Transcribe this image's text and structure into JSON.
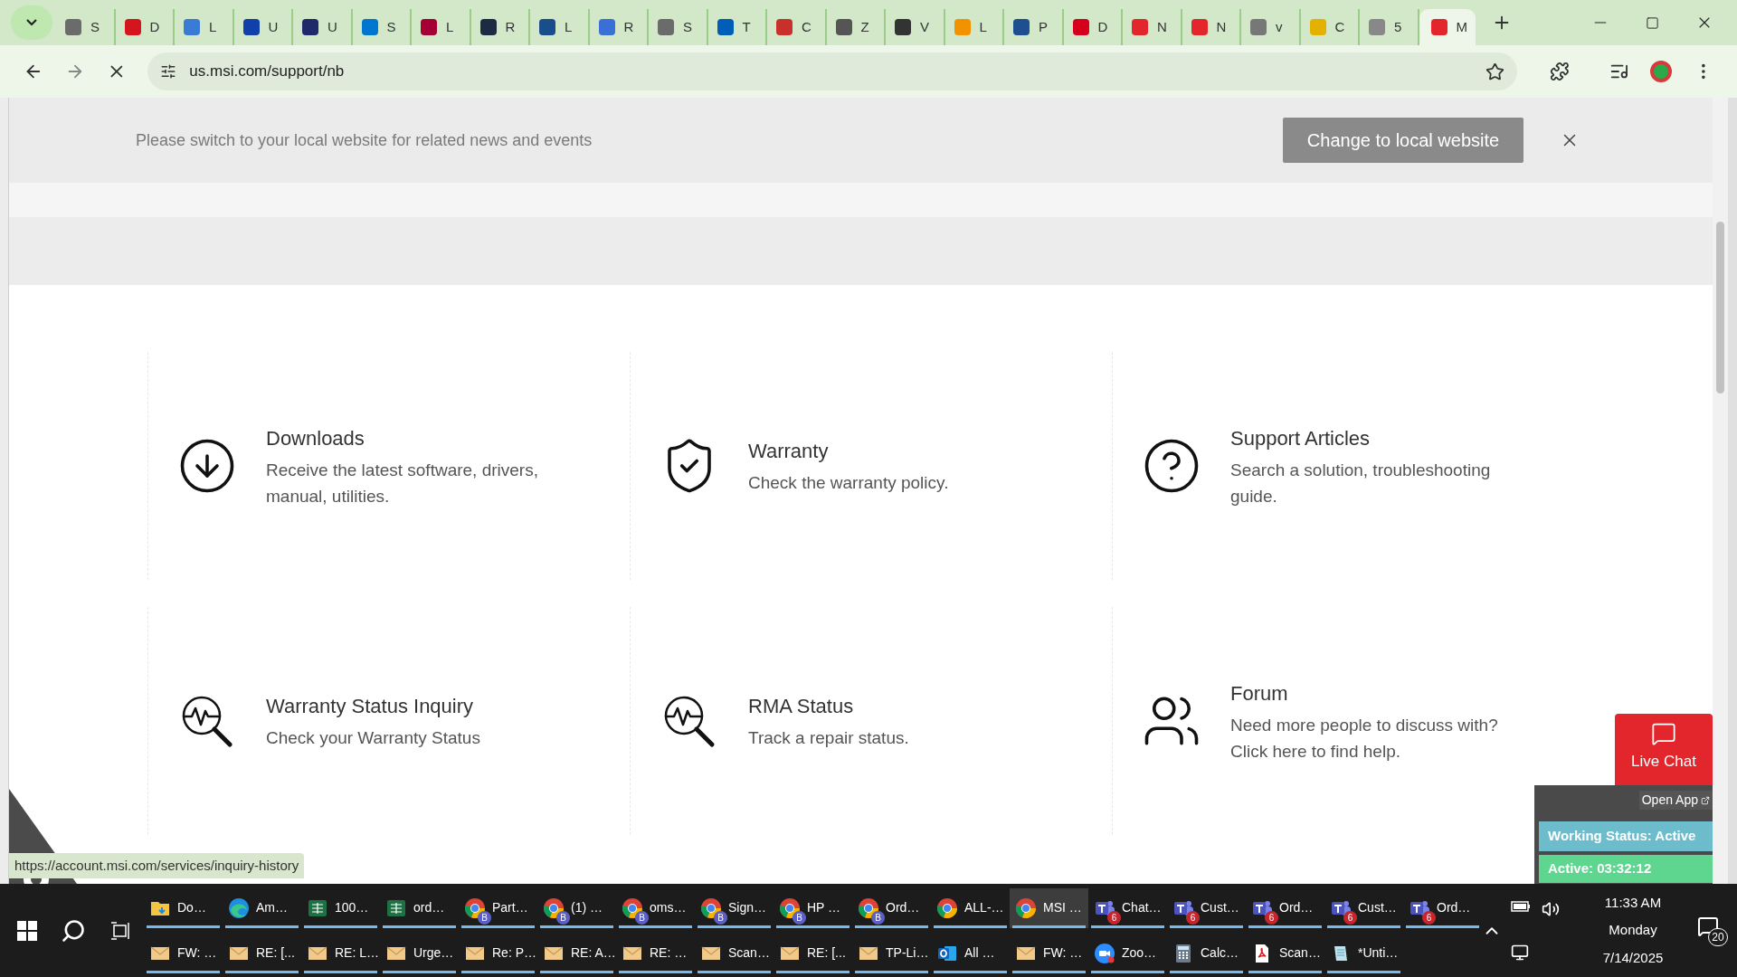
{
  "browser": {
    "tabs": [
      {
        "label": "S",
        "selected": false
      },
      {
        "label": "D",
        "selected": false
      },
      {
        "label": "L",
        "selected": false
      },
      {
        "label": "U",
        "selected": false
      },
      {
        "label": "U",
        "selected": false
      },
      {
        "label": "S",
        "selected": false
      },
      {
        "label": "L",
        "selected": false
      },
      {
        "label": "R",
        "selected": false
      },
      {
        "label": "L",
        "selected": false
      },
      {
        "label": "R",
        "selected": false
      },
      {
        "label": "S",
        "selected": false
      },
      {
        "label": "T",
        "selected": false
      },
      {
        "label": "C",
        "selected": false
      },
      {
        "label": "Z",
        "selected": false
      },
      {
        "label": "V",
        "selected": false
      },
      {
        "label": "L",
        "selected": false
      },
      {
        "label": "P",
        "selected": false
      },
      {
        "label": "D",
        "selected": false
      },
      {
        "label": "N",
        "selected": false
      },
      {
        "label": "N",
        "selected": false
      },
      {
        "label": "v",
        "selected": false
      },
      {
        "label": "C",
        "selected": false
      },
      {
        "label": "5",
        "selected": false
      },
      {
        "label": "M",
        "selected": true
      }
    ],
    "address": "us.msi.com/support/nb"
  },
  "banner": {
    "message": "Please switch to your local website for related news and events",
    "button": "Change to local website"
  },
  "support_links": [
    {
      "kind": "download",
      "title": "Downloads",
      "description": "Receive the latest software, drivers, manual, utilities."
    },
    {
      "kind": "shield",
      "title": "Warranty",
      "description": "Check the warranty policy."
    },
    {
      "kind": "question",
      "title": "Support Articles",
      "description": "Search a solution, troubleshooting guide."
    },
    {
      "kind": "pulse",
      "title": "Warranty Status Inquiry",
      "description": "Check your Warranty Status"
    },
    {
      "kind": "pulse",
      "title": "RMA Status",
      "description": "Track a repair status."
    },
    {
      "kind": "people",
      "title": "Forum",
      "description": "Need more people to discuss with? Click here to find help."
    }
  ],
  "live_chat": {
    "label": "Live Chat"
  },
  "status_widget": {
    "open_app": "Open App",
    "working_status": "Working Status: Active",
    "active_timer": "Active: 03:32:12"
  },
  "status_url": "https://account.msi.com/services/inquiry-history",
  "taskbar": {
    "row_1": [
      {
        "kind": "explorer",
        "label": "Do…",
        "selected": false
      },
      {
        "kind": "edge",
        "label": "Am…",
        "selected": false
      },
      {
        "kind": "excel",
        "label": "100…",
        "selected": false
      },
      {
        "kind": "excel",
        "label": "ord…",
        "selected": false
      },
      {
        "kind": "chrome",
        "label": "Part…",
        "badge": "B",
        "selected": false
      },
      {
        "kind": "chrome",
        "label": "(1) …",
        "badge": "B",
        "selected": false
      },
      {
        "kind": "chrome",
        "label": "oms…",
        "badge": "B",
        "selected": false
      },
      {
        "kind": "chrome",
        "label": "Sign…",
        "badge": "B",
        "selected": false
      },
      {
        "kind": "chrome",
        "label": "HP …",
        "badge": "B",
        "selected": false
      },
      {
        "kind": "chrome",
        "label": "Ord…",
        "badge": "B",
        "selected": false
      },
      {
        "kind": "chrome",
        "label": "ALL-…",
        "selected": false
      },
      {
        "kind": "chrome",
        "label": "MSI …",
        "selected": true
      },
      {
        "kind": "teams",
        "label": "Chat…",
        "badge": "6",
        "selected": false
      },
      {
        "kind": "teams",
        "label": "Cust…",
        "badge": "6",
        "selected": false
      },
      {
        "kind": "teams",
        "label": "Ord…",
        "badge": "6",
        "selected": false
      },
      {
        "kind": "teams",
        "label": "Cust…",
        "badge": "6",
        "selected": false
      },
      {
        "kind": "teams",
        "label": "Ord…",
        "badge": "6",
        "selected": false
      }
    ],
    "row_2": [
      {
        "kind": "mail",
        "label": "FW: …",
        "selected": false
      },
      {
        "kind": "mail",
        "label": "RE: [...",
        "selected": false
      },
      {
        "kind": "mail",
        "label": "RE: L…",
        "selected": false
      },
      {
        "kind": "mail",
        "label": "Urge…",
        "selected": false
      },
      {
        "kind": "mail",
        "label": "Re: P…",
        "selected": false
      },
      {
        "kind": "mail",
        "label": "RE: A…",
        "selected": false
      },
      {
        "kind": "mail",
        "label": "RE: …",
        "selected": false
      },
      {
        "kind": "mail",
        "label": "Scan…",
        "selected": false
      },
      {
        "kind": "mail",
        "label": "RE: [...",
        "selected": false
      },
      {
        "kind": "mail",
        "label": "TP-Li…",
        "selected": false
      },
      {
        "kind": "outlook",
        "label": "All …",
        "selected": false
      },
      {
        "kind": "mail",
        "label": "FW: …",
        "selected": false
      },
      {
        "kind": "zoom",
        "label": "Zoo…",
        "selected": false
      },
      {
        "kind": "calculator",
        "label": "Calc…",
        "selected": false
      },
      {
        "kind": "pdf",
        "label": "Scan…",
        "selected": false
      },
      {
        "kind": "notepad",
        "label": "*Unti…",
        "selected": false
      }
    ],
    "clock": {
      "time": "11:33 AM",
      "day": "Monday",
      "date": "7/14/2025"
    },
    "notifications": "20"
  }
}
